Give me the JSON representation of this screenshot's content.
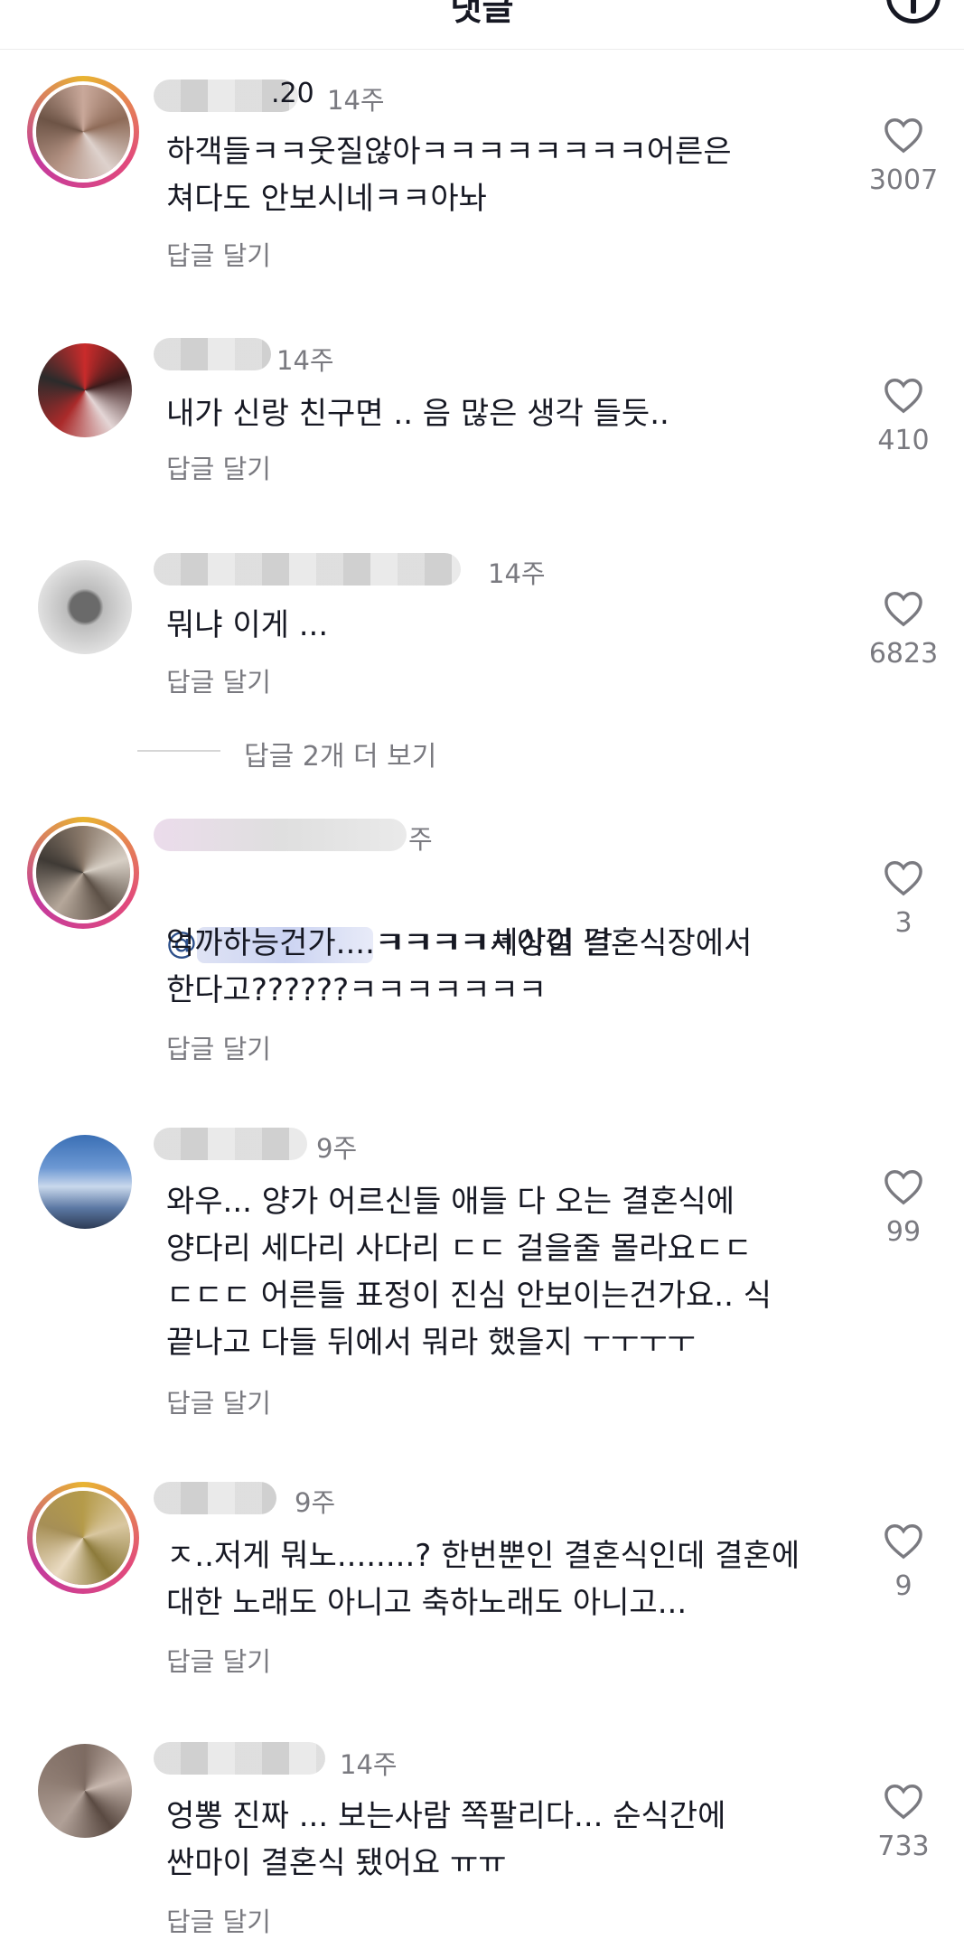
{
  "header": {
    "title": "댓글"
  },
  "reply_label": "답글 달기",
  "more_replies": "답글 2개 더 보기",
  "comments": [
    {
      "username_suffix": ".20",
      "time": "14주",
      "text": "하객들ㅋㅋ웃질않아ㅋㅋㅋㅋㅋㅋㅋㅋ어른은\n쳐다도 안보시네ㅋㅋ아놔",
      "likes": "3007"
    },
    {
      "username_suffix": "",
      "time": "14주",
      "text": "내가 신랑 친구면 .. 음 많은 생각 들듯..",
      "likes": "410"
    },
    {
      "username_suffix": "",
      "time": "14주",
      "text": "뭐냐 이게 ...",
      "likes": "6823"
    },
    {
      "username_suffix": "",
      "time": "주",
      "mention": "@",
      "text_after_mention": "ㅋㅋㅋㅋ세상이 날",
      "text": "억까하능건가....ㅋㅋㅋㅋㅋ이걸 결혼식장에서\n한다고??????ㅋㅋㅋㅋㅋㅋㅋ",
      "likes": "3"
    },
    {
      "username_suffix": "",
      "time": "9주",
      "text": "와우... 양가 어르신들 애들 다 오는 결혼식에\n양다리 세다리 사다리 ㄷㄷ  걸을줄 몰라요ㄷㄷ\nㄷㄷㄷ  어른들 표정이 진심 안보이는건가요.. 식\n끝나고 다들 뒤에서 뭐라 했을지 ㅜㅜㅜㅜ",
      "likes": "99"
    },
    {
      "username_suffix": "",
      "time": "9주",
      "text": "ㅈ..저게 뭐노........? 한번뿐인 결혼식인데 결혼에\n대한 노래도 아니고 축하노래도 아니고...",
      "likes": "9"
    },
    {
      "username_suffix": "",
      "time": "14주",
      "text": "엉뽕 진짜 ... 보는사람 쪽팔리다... 순식간에\n싼마이 결혼식 됐어요 ㅠㅠ",
      "likes": "733"
    }
  ]
}
